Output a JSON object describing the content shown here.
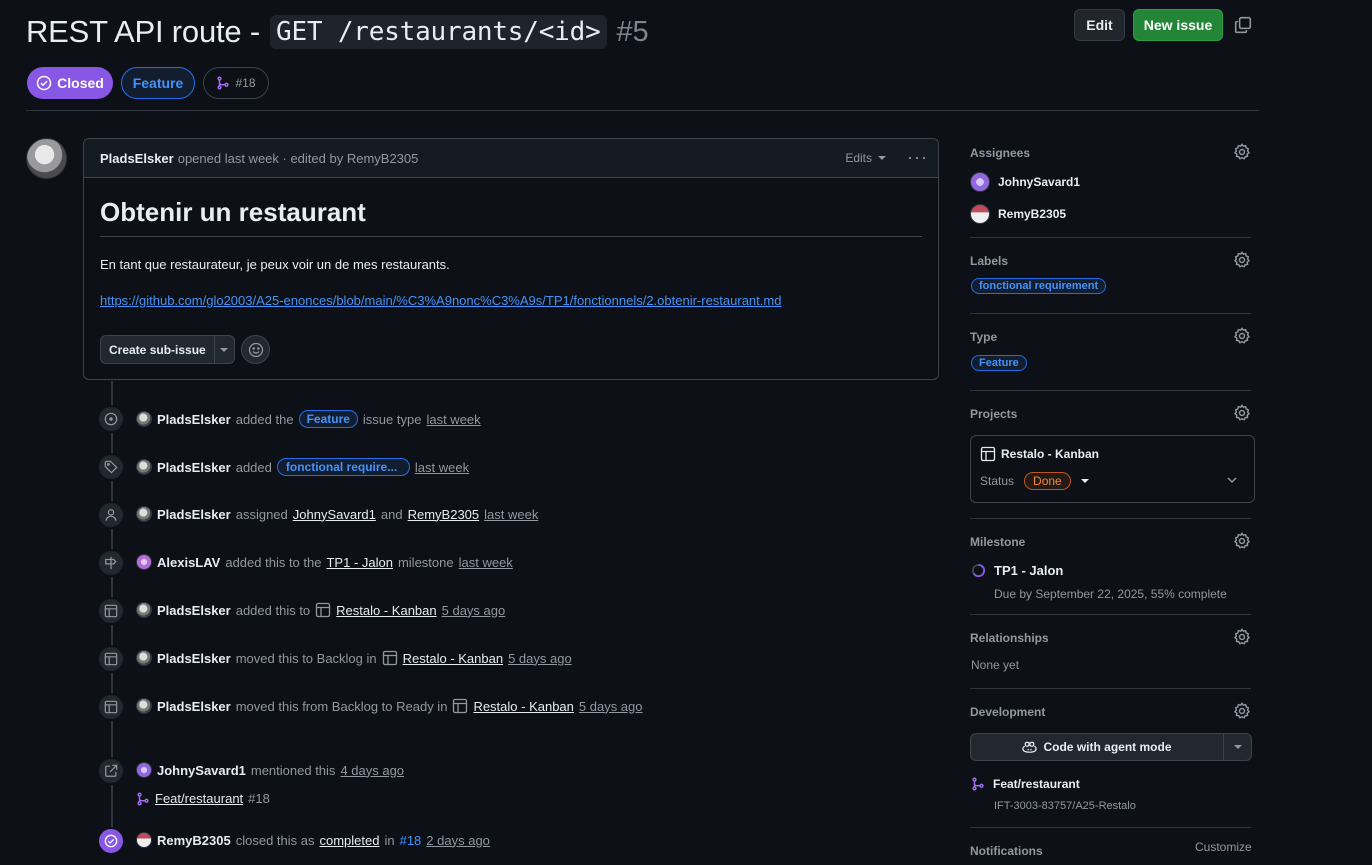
{
  "header": {
    "title": "REST API route - ",
    "title_code": "GET /restaurants/<id>",
    "number": "#5",
    "edit_label": "Edit",
    "new_issue_label": "New issue"
  },
  "badges": {
    "state": "Closed",
    "type": "Feature",
    "linked_pr": "#18"
  },
  "comment": {
    "author": "PladsElsker",
    "meta": "opened last week · edited by RemyB2305",
    "edits_label": "Edits",
    "heading": "Obtenir un restaurant",
    "body": "En tant que restaurateur, je peux voir un de mes restaurants.",
    "link": "https://github.com/glo2003/A25-enonces/blob/main/%C3%A9nonc%C3%A9s/TP1/fonctionnels/2.obtenir-restaurant.md",
    "sub_issue_label": "Create sub-issue"
  },
  "timeline": {
    "e1": {
      "who": "PladsElsker",
      "pre": "added the",
      "label": "Feature",
      "post": "issue type",
      "time": "last week"
    },
    "e2": {
      "who": "PladsElsker",
      "pre": "added",
      "label": "fonctional require...",
      "time": "last week"
    },
    "e3": {
      "who": "PladsElsker",
      "pre": "assigned",
      "u1": "JohnySavard1",
      "and": "and",
      "u2": "RemyB2305",
      "time": "last week"
    },
    "e4": {
      "who": "AlexisLAV",
      "pre": "added this to the",
      "milestone": "TP1 - Jalon",
      "post": "milestone",
      "time": "last week"
    },
    "e5": {
      "who": "PladsElsker",
      "pre": "added this to",
      "project": "Restalo - Kanban",
      "time": "5 days ago"
    },
    "e6": {
      "who": "PladsElsker",
      "pre": "moved this to Backlog in",
      "project": "Restalo - Kanban",
      "time": "5 days ago"
    },
    "e7": {
      "who": "PladsElsker",
      "pre": "moved this from Backlog to Ready in",
      "project": "Restalo - Kanban",
      "time": "5 days ago"
    },
    "e8": {
      "who": "JohnySavard1",
      "pre": "mentioned this",
      "time": "4 days ago",
      "ref_title": "Feat/restaurant",
      "ref_num": "#18"
    },
    "e9": {
      "who": "RemyB2305",
      "pre": "closed this as",
      "state": "completed",
      "in": "in",
      "pr": "#18",
      "time": "2 days ago"
    }
  },
  "sidebar": {
    "assignees": {
      "title": "Assignees",
      "users": [
        "JohnySavard1",
        "RemyB2305"
      ]
    },
    "labels": {
      "title": "Labels",
      "items": [
        "fonctional requirement"
      ]
    },
    "type": {
      "title": "Type",
      "value": "Feature"
    },
    "projects": {
      "title": "Projects",
      "name": "Restalo - Kanban",
      "status_label": "Status",
      "status": "Done"
    },
    "milestone": {
      "title": "Milestone",
      "name": "TP1 - Jalon",
      "due": "Due by September 22, 2025, 55% complete"
    },
    "relationships": {
      "title": "Relationships",
      "value": "None yet"
    },
    "development": {
      "title": "Development",
      "agent_label": "Code with agent mode",
      "branch": "Feat/restaurant",
      "repo": "IFT-3003-83757/A25-Restalo"
    },
    "notifications": {
      "title": "Notifications",
      "customize": "Customize"
    }
  },
  "colors": {
    "accent_green": "#238636",
    "closed_purple": "#8957e5",
    "link_blue": "#4493f8",
    "done_orange": "#f0883e"
  }
}
